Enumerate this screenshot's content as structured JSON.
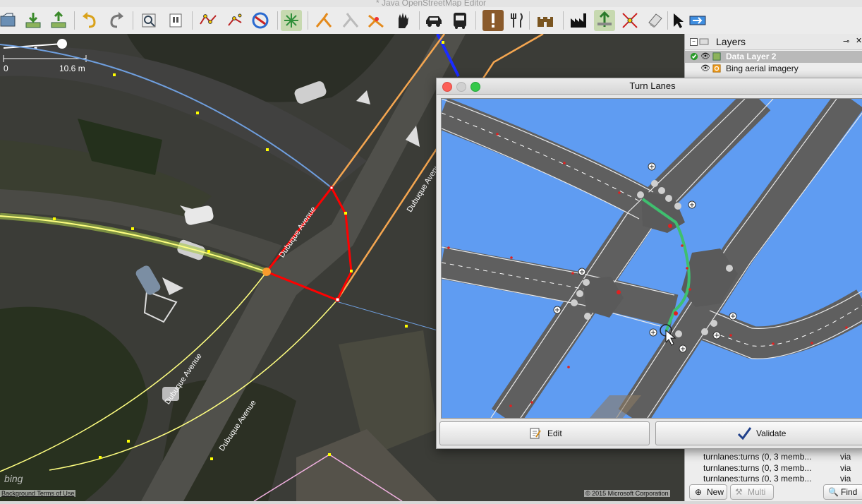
{
  "window": {
    "title": "* Java OpenStreetMap Editor"
  },
  "toolbar": {
    "buttons": [
      {
        "name": "open-file-icon"
      },
      {
        "name": "download-icon"
      },
      {
        "name": "upload-icon"
      },
      {
        "name": "undo-icon"
      },
      {
        "name": "redo-icon"
      },
      {
        "name": "preferences-icon"
      },
      {
        "name": "presets-icon"
      },
      {
        "name": "draw-icon"
      },
      {
        "name": "select-icon"
      },
      {
        "name": "refresh-icon"
      },
      {
        "name": "zoom-icon"
      },
      {
        "name": "split-way-icon"
      },
      {
        "name": "combine-way-icon"
      },
      {
        "name": "improve-way-icon"
      },
      {
        "name": "hand-icon"
      },
      {
        "name": "car-icon"
      },
      {
        "name": "bus-icon"
      },
      {
        "name": "warning-icon"
      },
      {
        "name": "restaurant-icon"
      },
      {
        "name": "castle-icon"
      },
      {
        "name": "factory-icon"
      },
      {
        "name": "turn-lanes-icon"
      },
      {
        "name": "intersection-icon"
      },
      {
        "name": "eraser-icon"
      },
      {
        "name": "cursor-icon"
      },
      {
        "name": "mode-arrow-icon"
      }
    ]
  },
  "map": {
    "scale": {
      "zero": "0",
      "distance": "10.6 m"
    },
    "bing_logo": "bing",
    "terms": "Background Terms of Use",
    "copyright": "© 2015 Microsoft Corporation",
    "street_labels": [
      "Dubuque Avenue",
      "Dubuque Avenue",
      "Dubuque Avenue",
      "Dubuque Avenue"
    ]
  },
  "layers_panel": {
    "title": "Layers",
    "layers": [
      {
        "name": "Data Layer 2",
        "selected": true
      },
      {
        "name": "Bing aerial imagery",
        "selected": false
      }
    ]
  },
  "relations": [
    {
      "text": "turnlanes:turns (0, 3 memb...",
      "via": "via"
    },
    {
      "text": "turnlanes:turns (0, 3 memb...",
      "via": "via"
    },
    {
      "text": "turnlanes:turns (0, 3 memb...",
      "via": "via"
    }
  ],
  "panel_buttons": {
    "new": "New",
    "multi": "Multi",
    "find": "Find"
  },
  "turn_lanes_dialog": {
    "title": "Turn Lanes",
    "edit_label": "Edit",
    "validate_label": "Validate",
    "colors": {
      "water": "#5f9cf2",
      "road": "#6b6b6b",
      "turn_path": "#3fbf6f"
    }
  }
}
